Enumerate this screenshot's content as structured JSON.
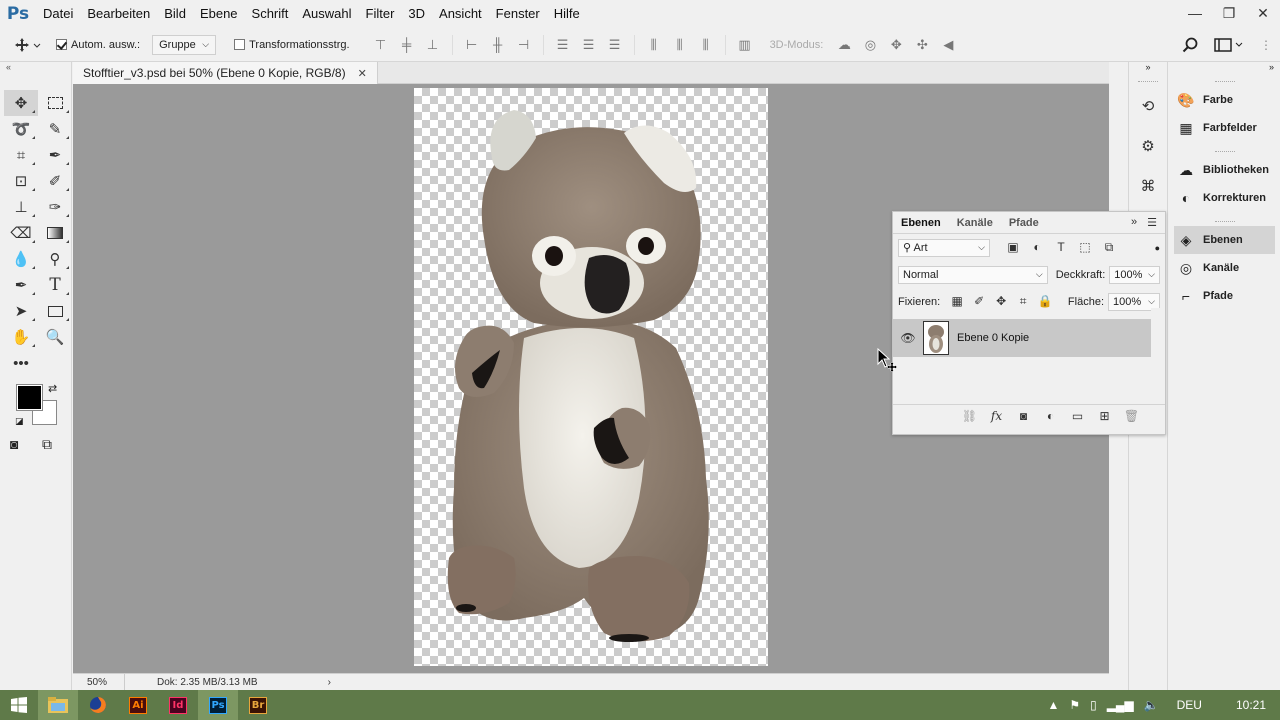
{
  "app": {
    "logo": "Ps"
  },
  "menu": [
    "Datei",
    "Bearbeiten",
    "Bild",
    "Ebene",
    "Schrift",
    "Auswahl",
    "Filter",
    "3D",
    "Ansicht",
    "Fenster",
    "Hilfe"
  ],
  "window_controls": {
    "minimize": "—",
    "restore": "❐",
    "close": "✕"
  },
  "options": {
    "auto_select_label": "Autom. ausw.:",
    "auto_select_checked": true,
    "auto_select_target": "Gruppe",
    "transform_label": "Transformationsstrg.",
    "transform_checked": false,
    "mode_3d": "3D-Modus:"
  },
  "document": {
    "tab_title": "Stofftier_v3.psd bei 50% (Ebene 0 Kopie, RGB/8)",
    "zoom": "50%",
    "doc_info": "Dok: 2.35 MB/3.13 MB"
  },
  "right_panels": [
    {
      "label": "Farbe",
      "icon": "color-wheel-icon"
    },
    {
      "label": "Farbfelder",
      "icon": "swatches-grid-icon"
    },
    {
      "label": "Bibliotheken",
      "icon": "libraries-icon"
    },
    {
      "label": "Korrekturen",
      "icon": "adjustments-icon"
    },
    {
      "label": "Ebenen",
      "icon": "layers-icon"
    },
    {
      "label": "Kanäle",
      "icon": "channels-icon"
    },
    {
      "label": "Pfade",
      "icon": "paths-icon"
    }
  ],
  "layers_panel": {
    "tabs": [
      "Ebenen",
      "Kanäle",
      "Pfade"
    ],
    "filter_kind": "Art",
    "blend_mode": "Normal",
    "opacity_label": "Deckkraft:",
    "opacity_value": "100%",
    "lock_label": "Fixieren:",
    "fill_label": "Fläche:",
    "fill_value": "100%",
    "layers": [
      {
        "name": "Ebene 0 Kopie",
        "visible": true,
        "selected": true
      }
    ]
  },
  "taskbar": {
    "apps": [
      {
        "name": "file-explorer",
        "label": ""
      },
      {
        "name": "firefox",
        "label": ""
      },
      {
        "name": "illustrator",
        "label": "Ai",
        "color": "#ff7c00",
        "bg": "#4b0c0c"
      },
      {
        "name": "indesign",
        "label": "Id",
        "color": "#ff3366",
        "bg": "#49021f"
      },
      {
        "name": "photoshop",
        "label": "Ps",
        "color": "#31a8ff",
        "bg": "#001e36"
      },
      {
        "name": "bridge",
        "label": "Br",
        "color": "#e8a63c",
        "bg": "#3a1204"
      }
    ],
    "language": "DEU",
    "time": "10:21"
  }
}
